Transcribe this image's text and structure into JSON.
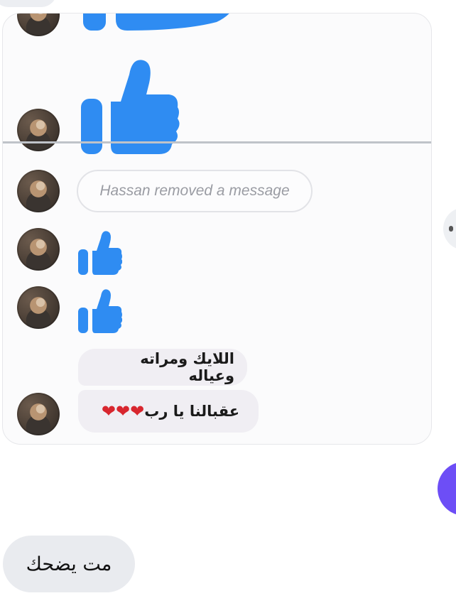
{
  "chat": {
    "removed_notice": "Hassan removed a message",
    "message_1": "اللايك ومراته وعياله",
    "message_2": "عقبالنا يا رب",
    "message_2_emoji": "❤❤❤"
  },
  "reply": {
    "text": "مت يضحك"
  },
  "icons": {
    "thumb": "thumbs-up-icon",
    "heart": "red-heart-emoji"
  },
  "colors": {
    "thumb_blue": "#2f8cf2",
    "heart_red": "#d8262e",
    "accent_purple": "#6d4ef6",
    "bubble_grey": "#e9ebef"
  }
}
